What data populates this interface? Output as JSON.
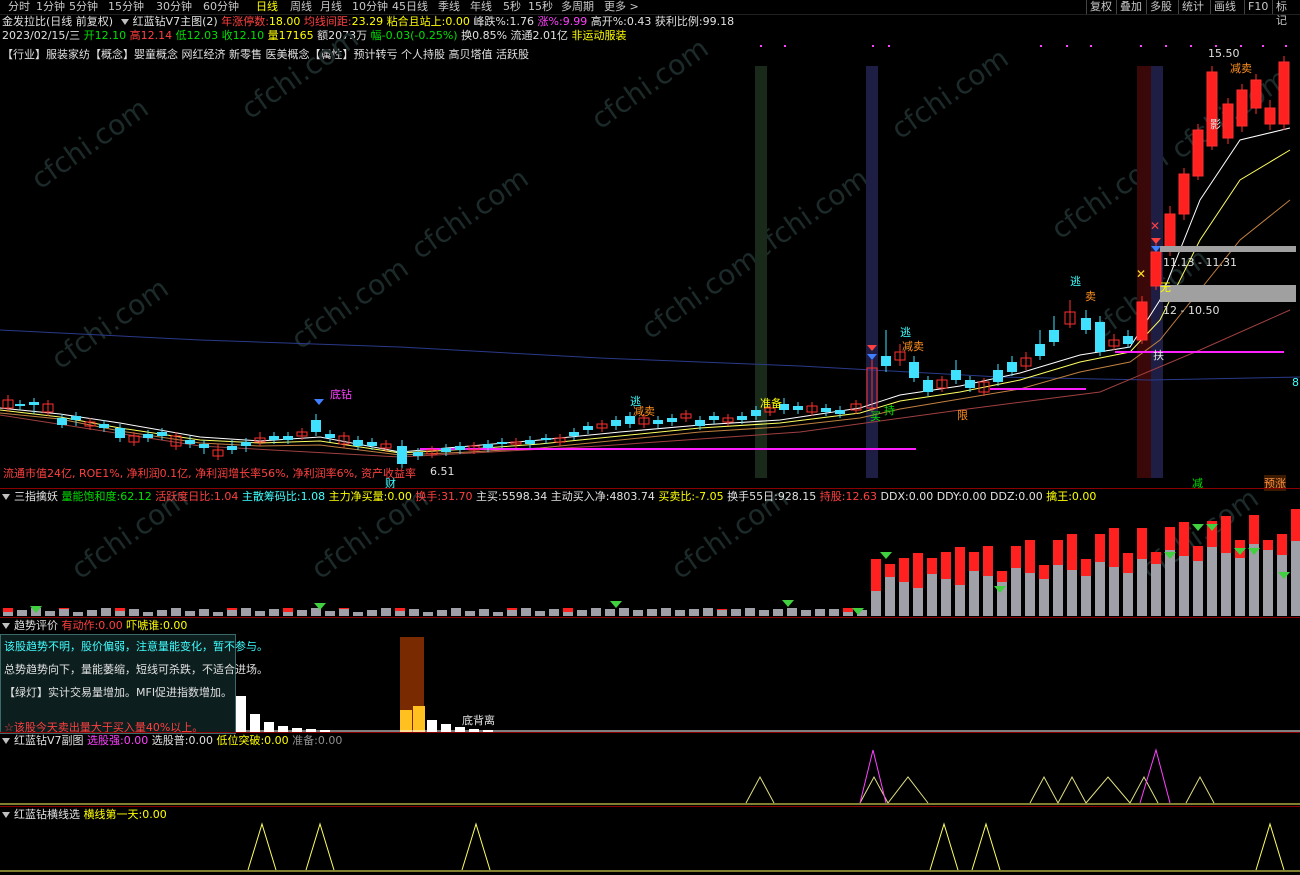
{
  "toolbar": {
    "periods": [
      "分时",
      "1分钟",
      "5分钟",
      "15分钟",
      "30分钟",
      "60分钟",
      "日线",
      "周线",
      "月线",
      "10分钟",
      "45日线",
      "季线",
      "年线",
      "5秒",
      "15秒",
      "多周期",
      "更多 >"
    ],
    "active": "日线",
    "right_buttons": [
      "复权",
      "叠加",
      "多股",
      "统计",
      "画线",
      "F10",
      "标记"
    ]
  },
  "header": {
    "stock_line": "金发拉比(日线 前复权)",
    "indicator": "红蓝钻V7主图(2)",
    "limit_up_label": "年涨停数:",
    "limit_up_value": "18.00",
    "ma_dist_label": "均线间距:",
    "ma_dist_value": "23.29",
    "stick_label": "粘合且站上:",
    "stick_value": "0.00",
    "fall_label": "峰跌%:",
    "fall_value": "1.76",
    "rise_label": "涨%:",
    "rise_value": "9.99",
    "open_high_label": "高开%:",
    "open_high_value": "0.43",
    "profit_label": "获利比例:",
    "profit_value": "99.18"
  },
  "quote": {
    "date": "2023/02/15/三",
    "open": "开12.10",
    "high": "高12.14",
    "low": "低12.03",
    "close": "收12.10",
    "vol": "量17165",
    "amount": "额2073万",
    "change": "幅-0.03(-0.25%)",
    "turnover": "换0.85%",
    "float": "流通2.01亿",
    "sector": "非运动服装"
  },
  "tags_line": "【行业】服装家纺【概念】婴童概念 网红经济 新零售 医美概念【属性】预计转亏 个人持股 高贝塔值 活跃股",
  "fundamentals": "流通市值24亿, ROE1%, 净利润0.1亿, 净利润增长率56%, 净利润率6%, 资产收益率",
  "main_labels": {
    "diamond_buy": "底钻",
    "escape1": "逃",
    "reduce1": "减卖",
    "prepare": "准备",
    "escape2": "逃",
    "reduce2": "减卖",
    "buy": "买",
    "hold": "持",
    "limit": "限",
    "escape3": "逃",
    "sell3": "卖",
    "box1": "11.13 - 11.31",
    "box2": "12 - 10.50",
    "top_price": "15.50",
    "top_reduce": "减卖",
    "support": "扶",
    "cai": "财",
    "price_651": "6.51",
    "reduce_bottom": "减",
    "warn_bottom": "预涨",
    "right_edge": "8",
    "jian_top": "影",
    "wu": "无"
  },
  "panel2": {
    "title": "三指擒妖",
    "items": [
      {
        "label": "量能饱和度:",
        "value": "62.12",
        "color": "#00e000"
      },
      {
        "label": "活跃度日比:",
        "value": "1.04",
        "color": "#ff4040"
      },
      {
        "label": "主散筹码比:",
        "value": "1.08",
        "color": "#40ffff"
      },
      {
        "label": "主力净买量:",
        "value": "0.00",
        "color": "#ffff00"
      },
      {
        "label": "换手:",
        "value": "31.70",
        "color": "#ff4040"
      },
      {
        "label": "主买:",
        "value": "5598.34",
        "color": "#e0e0e0"
      },
      {
        "label": "主动买入净:",
        "value": "4803.74",
        "color": "#e0e0e0"
      },
      {
        "label": "买卖比:",
        "value": "-7.05",
        "color": "#ffff00"
      },
      {
        "label": "换手55日:",
        "value": "928.15",
        "color": "#e0e0e0"
      },
      {
        "label": "持股:",
        "value": "12.63",
        "color": "#ff4040"
      },
      {
        "label": "DDX:",
        "value": "0.00",
        "color": "#e0e0e0"
      },
      {
        "label": "DDY:",
        "value": "0.00",
        "color": "#e0e0e0"
      },
      {
        "label": "DDZ:",
        "value": "0.00",
        "color": "#e0e0e0"
      },
      {
        "label": "擒王:",
        "value": "0.00",
        "color": "#ffff00"
      }
    ]
  },
  "panel3": {
    "title": "趋势评价",
    "item1_label": "有动作:",
    "item1_value": "0.00",
    "item2_label": "吓唬谁:",
    "item2_value": "0.00",
    "lines": [
      "该股趋势不明，股价偏弱，注意量能变化，暂不参与。",
      "总势趋势向下，量能萎缩，短线可杀跌，不适合进场。",
      "【绿灯】实计交易量增加。MFI促进指数增加。",
      "☆该股今天卖出量大于买入量40%以上。"
    ],
    "bottom_label": "底背离"
  },
  "panel4": {
    "title": "红蓝钻V7副图",
    "items": [
      {
        "label": "选股强:",
        "value": "0.00",
        "color": "#ff40ff"
      },
      {
        "label": "选股普:",
        "value": "0.00",
        "color": "#e0e0e0"
      },
      {
        "label": "低位突破:",
        "value": "0.00",
        "color": "#ffff00"
      },
      {
        "label": "准备:",
        "value": "0.00",
        "color": "#909090"
      }
    ]
  },
  "panel5": {
    "title": "红蓝钻横线选",
    "label": "横线第一天:",
    "value": "0.00"
  },
  "watermark": "cfchi.com"
}
